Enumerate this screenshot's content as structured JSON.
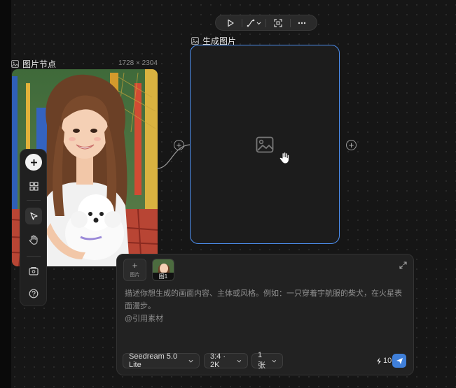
{
  "toolbar": {
    "buttons": [
      {
        "name": "play-icon"
      },
      {
        "name": "connector-style-icon"
      },
      {
        "name": "fit-screen-icon"
      },
      {
        "name": "more-icon"
      }
    ]
  },
  "image_node": {
    "icon": "image-icon",
    "title": "图片节点",
    "dimensions": "1728 × 2304"
  },
  "generate_node": {
    "icon": "image-icon",
    "title": "生成图片",
    "placeholder_icon": "image-placeholder-icon"
  },
  "rail": {
    "items": [
      "plus-icon",
      "grid-icon",
      "cursor-icon",
      "hand-icon",
      "card-icon",
      "help-icon"
    ]
  },
  "prompt": {
    "add_ref_label": "图片",
    "ref_tag": "图1",
    "placeholder_line1": "描述你想生成的画面内容、主体或风格。例如：一只穿着宇航服的柴犬，在火星表面漫步。",
    "placeholder_line2": "@引用素材",
    "model": "Seedream 5.0 Lite",
    "ratio": "3:4 · 2K",
    "count": "1张",
    "credits": "10",
    "colors": {
      "accent": "#4d8ff0",
      "send": "#3f7fd9"
    }
  }
}
